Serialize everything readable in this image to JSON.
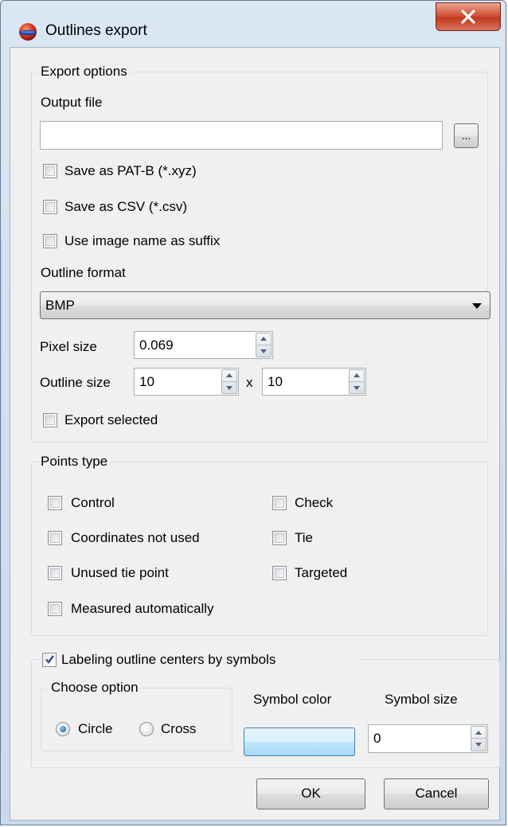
{
  "window": {
    "title": "Outlines export",
    "icon": "app-sphere-icon",
    "close_icon": "close-x-icon"
  },
  "export_options": {
    "group_title": "Export options",
    "output_file_label": "Output file",
    "output_file_value": "",
    "browse_label": "...",
    "save_pat_b_label": "Save as PAT-B (*.xyz)",
    "save_pat_b_checked": false,
    "save_csv_label": "Save as CSV (*.csv)",
    "save_csv_checked": false,
    "use_image_name_label": "Use image name as suffix",
    "use_image_name_checked": false,
    "outline_format_label": "Outline format",
    "outline_format_value": "BMP",
    "pixel_size_label": "Pixel size",
    "pixel_size_value": "0.069",
    "outline_size_label": "Outline size",
    "outline_width_value": "10",
    "outline_x_label": "x",
    "outline_height_value": "10",
    "export_selected_label": "Export selected",
    "export_selected_checked": false
  },
  "points_type": {
    "group_title": "Points type",
    "items": [
      {
        "label": "Control",
        "checked": false
      },
      {
        "label": "Check",
        "checked": false
      },
      {
        "label": "Coordinates not used",
        "checked": false
      },
      {
        "label": "Tie",
        "checked": false
      },
      {
        "label": "Unused tie point",
        "checked": false
      },
      {
        "label": "Targeted",
        "checked": false
      },
      {
        "label": "Measured automatically",
        "checked": false
      }
    ]
  },
  "labeling": {
    "group_title": "Labeling outline centers by symbols",
    "checked": true,
    "choose_option_title": "Choose option",
    "circle_label": "Circle",
    "circle_selected": true,
    "cross_label": "Cross",
    "cross_selected": false,
    "symbol_color_label": "Symbol color",
    "symbol_size_label": "Symbol size",
    "symbol_size_value": "0"
  },
  "footer": {
    "ok_label": "OK",
    "cancel_label": "Cancel"
  },
  "colors": {
    "window_frame": "#c9d9ec",
    "client_background": "#f0f0f0",
    "close_button": "#c23a20",
    "symbol_color_swatch": "#bee6fd"
  }
}
